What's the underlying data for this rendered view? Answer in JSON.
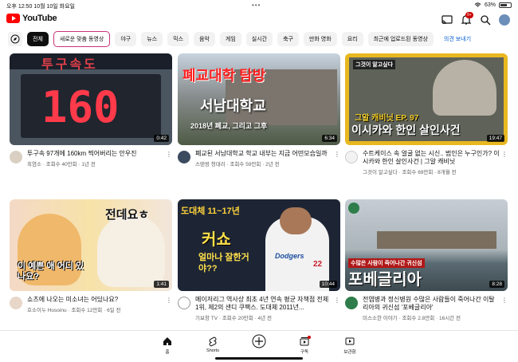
{
  "status_bar": {
    "time": "오후 12:50",
    "date": "10월 10일 화요일",
    "battery": "63%"
  },
  "header": {
    "logo_text": "YouTube",
    "notification_count": "9+"
  },
  "chips": [
    "전체",
    "새로운 맞춤 동영상",
    "야구",
    "뉴스",
    "믹스",
    "음악",
    "게임",
    "실시간",
    "축구",
    "만화 영화",
    "요리",
    "최근에 업로드된 동영상"
  ],
  "chips_link": "의견 보내기",
  "videos": [
    {
      "title": "투구속 97개에 160km 찍어버리는 안우진",
      "sub": "흑염소 · 조회수 40만회 · 1년 전",
      "duration": "0:42",
      "thumb_text": "160",
      "thumb_header": "투구속도"
    },
    {
      "title": "폐교된 서남대학교 학교 내부는 지금 어떤모습일까",
      "sub": "스탠왕 청대리 · 조회수 59만회 · 2년 전",
      "duration": "6:34",
      "thumb_text": "폐교대학 탐방",
      "thumb_text2": "서남대학교",
      "thumb_text3": "2018년 폐교, 그리고 그후"
    },
    {
      "title": "수트케이스 속 얼굴 없는 시신.. 범인은 누구인가? 이시카와 한인 살인사건 | 그알 캐비닛",
      "sub": "그것이 알고싶다 · 조회수 69만회 · 8개월 전",
      "duration": "19:47",
      "thumb_text": "그알 캐비닛 EP. 97",
      "thumb_text2": "이시카와 한인 살인사건",
      "thumb_header": "그것이 알고싶다"
    },
    {
      "title": "쇼츠에 나오는 미소녀는 어딨나요?",
      "sub": "호소이누 Hosoinu · 조회수 12만회 · 6일 전",
      "duration": "1:41",
      "thumb_text": "전데요ㅎ",
      "thumb_text2": "이 예쁜 애 어디 있나요?"
    },
    {
      "title": "메이저리그 역사상 최초 4년 연속 평균 자책점 전체 1위, 제2의 샌디 쿠팩스. 도대체 2011년...",
      "sub": "기보창 TV · 조회수 20만회 · 4년 전",
      "duration": "10:44",
      "thumb_text": "도대체 11~17년",
      "thumb_text2": "커쇼",
      "thumb_text3": "얼마나 잘한거야??",
      "jersey": "Dodgers",
      "jersey_num": "22"
    },
    {
      "title": "전염병과 정신병원 수많은 사람들이 죽어나간 이탈리아의 귀신섬 '포베글리아'",
      "sub": "미스소한 이야기 · 조회수 2.8만회 · 16시간 전",
      "duration": "8:28",
      "thumb_text": "수많은 사람이 죽어나간 귀신섬",
      "thumb_text2": "포베글리아"
    }
  ],
  "bottom_nav": [
    "홈",
    "Shorts",
    "",
    "구독",
    "보관함"
  ],
  "colors": {
    "accent_red": "#ff0000",
    "link_blue": "#065fd4"
  }
}
